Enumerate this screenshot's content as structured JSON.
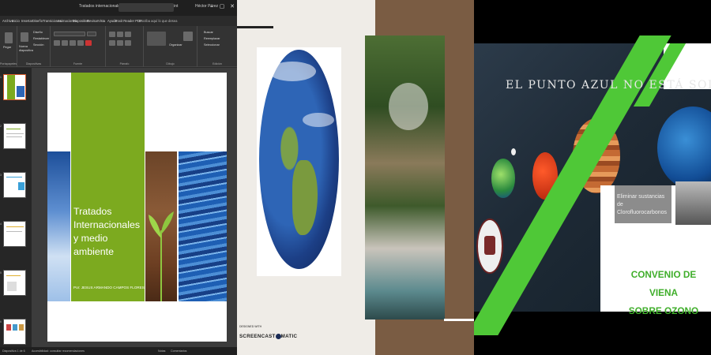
{
  "powerpoint": {
    "window_title": "Tratados internacionales y medio ambiente - PowerPoint",
    "user": "Héctor Pérez",
    "search_hint": "Buscar",
    "menu": [
      "Archivo",
      "Inicio",
      "Insertar",
      "Diseño",
      "Transiciones",
      "Animaciones",
      "Presentación con diapositivas",
      "Revisar",
      "Vista",
      "Ayuda",
      "Foxit Reader PDF"
    ],
    "menu_visible": [
      "Archivo",
      "Inicio",
      "Insertar",
      "Diseño",
      "Transiciones",
      "Animaciones",
      "Diapositiva",
      "Revisar",
      "Vista",
      "Ayuda",
      "Foxit Reader PDF"
    ],
    "tell_me": "Escriba aquí lo que desea",
    "ribbon_groups": [
      {
        "name": "Portapapeles",
        "items": [
          "Pegar"
        ]
      },
      {
        "name": "Diapositivas",
        "items": [
          "Nueva diapositiva",
          "Diseño",
          "Restablecer",
          "Sección"
        ]
      },
      {
        "name": "Fuente",
        "items": []
      },
      {
        "name": "Párrafo",
        "items": []
      },
      {
        "name": "Dibujo",
        "items": [
          "Organizar",
          "Estilos rápidos"
        ]
      },
      {
        "name": "Edición",
        "items": [
          "Buscar",
          "Reemplazar",
          "Seleccionar"
        ]
      }
    ],
    "slide": {
      "title": "Tratados Internacionales y medio ambiente",
      "author": "Por: JESUS ARMANDO CAMPOS FLORES"
    },
    "thumbnail_numbers": [
      "1",
      "2",
      "3",
      "4",
      "5",
      "6"
    ],
    "status": {
      "slide_of": "Diapositiva 1 de 6",
      "language": "Español (México)",
      "accessibility": "Accesibilidad: consultar recomendaciones",
      "notes": "Notas",
      "comments": "Comentarios"
    },
    "accent_color": "#7caa1f",
    "selected_color": "#d35a2a"
  },
  "collage": {
    "credit_top": "DESIGNED WITH",
    "credit_logo_before": "SCREENCAST",
    "credit_logo_after": "MATIC",
    "background": "#efece7",
    "brown": "#7a5c43"
  },
  "ozone_slide": {
    "title": "EL PUNTO AZUL NO ESTÁ SOLO",
    "eliminate_text": "Eliminar sustancias de Clorofluorocarbonos",
    "convenio_line1": "CONVENIO DE VIENA",
    "convenio_line2": "SOBRE OZONO",
    "green": "#4fc837"
  }
}
